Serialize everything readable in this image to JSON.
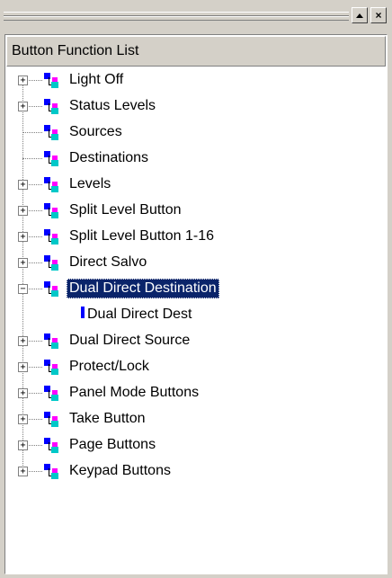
{
  "toolbar": {
    "up_glyph": "▲",
    "close_glyph": "×"
  },
  "panel": {
    "header": "Button Function List"
  },
  "tree": {
    "items": [
      {
        "label": "Light Off",
        "expander": "+"
      },
      {
        "label": "Status Levels",
        "expander": "+"
      },
      {
        "label": "Sources",
        "expander": ""
      },
      {
        "label": "Destinations",
        "expander": ""
      },
      {
        "label": "Levels",
        "expander": "+"
      },
      {
        "label": "Split Level Button",
        "expander": "+"
      },
      {
        "label": "Split Level Button 1-16",
        "expander": "+"
      },
      {
        "label": "Direct Salvo",
        "expander": "+"
      },
      {
        "label": "Dual Direct Destination",
        "expander": "−",
        "selected": true,
        "children": [
          {
            "label": "Dual Direct Dest"
          }
        ]
      },
      {
        "label": "Dual Direct Source",
        "expander": "+"
      },
      {
        "label": "Protect/Lock",
        "expander": "+"
      },
      {
        "label": "Panel Mode Buttons",
        "expander": "+"
      },
      {
        "label": "Take Button",
        "expander": "+"
      },
      {
        "label": "Page Buttons",
        "expander": "+"
      },
      {
        "label": "Keypad Buttons",
        "expander": "+"
      }
    ]
  },
  "colors": {
    "selection": "#0a246a",
    "node_blue": "#0000ff",
    "node_magenta": "#ff00ff",
    "node_cyan": "#00c8c8"
  }
}
